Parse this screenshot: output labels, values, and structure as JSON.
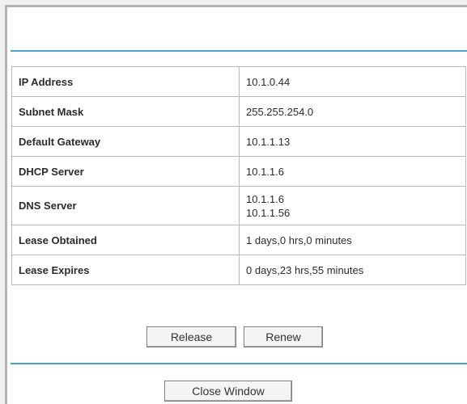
{
  "table": {
    "rows": [
      {
        "label": "IP Address",
        "value": "10.1.0.44"
      },
      {
        "label": "Subnet Mask",
        "value": "255.255.254.0"
      },
      {
        "label": "Default Gateway",
        "value": "10.1.1.13"
      },
      {
        "label": "DHCP Server",
        "value": "10.1.1.6"
      },
      {
        "label": "DNS Server",
        "values": [
          "10.1.1.6",
          "10.1.1.56"
        ]
      },
      {
        "label": "Lease Obtained",
        "value": "1 days,0 hrs,0 minutes"
      },
      {
        "label": "Lease Expires",
        "value": "0 days,23 hrs,55 minutes"
      }
    ]
  },
  "buttons": {
    "release": "Release",
    "renew": "Renew",
    "close": "Close Window"
  },
  "colors": {
    "accent_rule": "#4aa3cf",
    "cell_border": "#b8b8b8"
  }
}
